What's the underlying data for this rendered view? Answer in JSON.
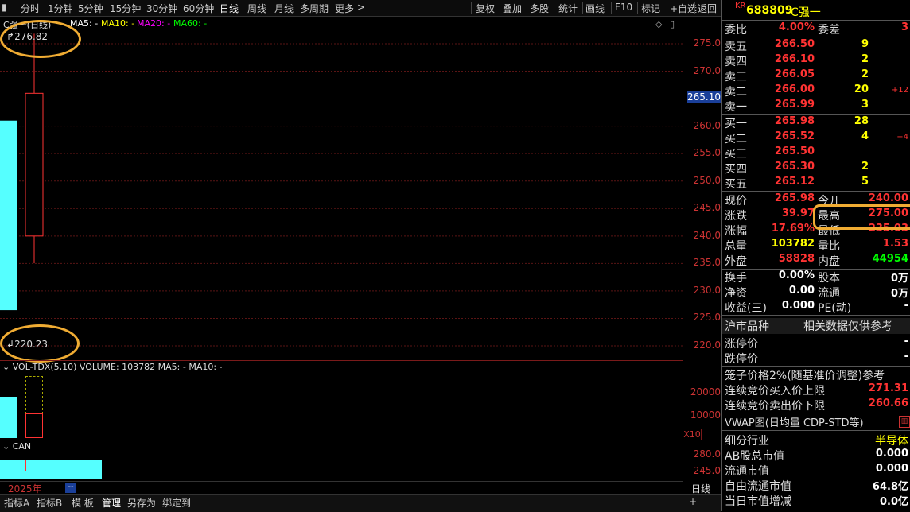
{
  "toolbar": {
    "periods": [
      "分时",
      "1分钟",
      "5分钟",
      "15分钟",
      "30分钟",
      "60分钟",
      "日线",
      "周线",
      "月线",
      "多周期",
      "更多"
    ],
    "actions": [
      "复权",
      "叠加",
      "多股",
      "统计",
      "画线",
      "F10",
      "标记",
      "+自选",
      "返回"
    ]
  },
  "chart": {
    "title": "C强一(日线)",
    "ma_labels": {
      "ma5": "MA5: -",
      "ma10": "MA10: -",
      "ma20": "MA20: -",
      "ma60": "MA60: -"
    },
    "high_label": "276.82",
    "low_label": "220.23",
    "yticks": [
      "275.0",
      "270.0",
      "265.10",
      "260.0",
      "255.0",
      "250.0",
      "245.0",
      "240.0",
      "235.0",
      "230.0",
      "225.0",
      "220.0"
    ],
    "current_price_tag": "265.10",
    "candle": {
      "open": 240.0,
      "close": 265.98,
      "high": 276.82,
      "low": 235.03
    }
  },
  "volume": {
    "header": "VOL-TDX(5,10) VOLUME: 103782 MA5: - MA10: -",
    "yticks": [
      "20000",
      "10000"
    ],
    "unit": "X10"
  },
  "can": {
    "label": "CAN",
    "yticks": [
      "280.0",
      "245.0"
    ],
    "year": "2025年",
    "period": "日线"
  },
  "bottom_tabs": [
    "指标A",
    "指标B",
    "模 板",
    "管理",
    "另存为",
    "绑定到"
  ],
  "quote": {
    "market": "KR",
    "code": "688809",
    "name": "C强一",
    "weibi_label": "委比",
    "weibi": "4.00%",
    "weicha_label": "委差",
    "weicha": "3",
    "asks": [
      {
        "label": "卖五",
        "price": "266.50",
        "vol": "9",
        "chg": ""
      },
      {
        "label": "卖四",
        "price": "266.10",
        "vol": "2",
        "chg": ""
      },
      {
        "label": "卖三",
        "price": "266.05",
        "vol": "2",
        "chg": ""
      },
      {
        "label": "卖二",
        "price": "266.00",
        "vol": "20",
        "chg": "+12"
      },
      {
        "label": "卖一",
        "price": "265.99",
        "vol": "3",
        "chg": ""
      }
    ],
    "bids": [
      {
        "label": "买一",
        "price": "265.98",
        "vol": "28",
        "chg": ""
      },
      {
        "label": "买二",
        "price": "265.52",
        "vol": "4",
        "chg": "+4"
      },
      {
        "label": "买三",
        "price": "265.50",
        "vol": "",
        "chg": ""
      },
      {
        "label": "买四",
        "price": "265.30",
        "vol": "2",
        "chg": ""
      },
      {
        "label": "买五",
        "price": "265.12",
        "vol": "5",
        "chg": ""
      }
    ],
    "stats": [
      {
        "l1": "现价",
        "v1": "265.98",
        "l2": "今开",
        "v2": "240.00"
      },
      {
        "l1": "涨跌",
        "v1": "39.97",
        "l2": "最高",
        "v2": "275.00"
      },
      {
        "l1": "涨幅",
        "v1": "17.69%",
        "l2": "最低",
        "v2": "235.03"
      },
      {
        "l1": "总量",
        "v1": "103782",
        "l2": "量比",
        "v2": "1.53"
      },
      {
        "l1": "外盘",
        "v1": "58828",
        "l2": "内盘",
        "v2": "44954"
      }
    ],
    "stats2": [
      {
        "l1": "换手",
        "v1": "0.00%",
        "l2": "股本",
        "v2": "0万"
      },
      {
        "l1": "净资",
        "v1": "0.00",
        "l2": "流通",
        "v2": "0万"
      },
      {
        "l1": "收益(三)",
        "v1": "0.000",
        "l2": "PE(动)",
        "v2": "-"
      }
    ],
    "shi_label": "沪市品种",
    "shi_note": "相关数据仅供参考",
    "zhangting_label": "涨停价",
    "zhangting": "-",
    "dieting_label": "跌停价",
    "dieting": "-",
    "cage_label": "笼子价格2%(随基准价调整)参考",
    "up_limit_label": "连续竞价买入价上限",
    "up_limit": "271.31",
    "down_limit_label": "连续竞价卖出价下限",
    "down_limit": "260.66",
    "vwap_label": "VWAP图(日均量 CDP-STD等)",
    "industry_label": "细分行业",
    "industry": "半导体",
    "ab_cap_label": "AB股总市值",
    "ab_cap": "0.000",
    "float_cap_label": "流通市值",
    "float_cap": "0.000",
    "free_cap_label": "自由流通市值",
    "free_cap": "64.8亿",
    "day_change_label": "当日市值增减",
    "day_change": "0.0亿"
  }
}
